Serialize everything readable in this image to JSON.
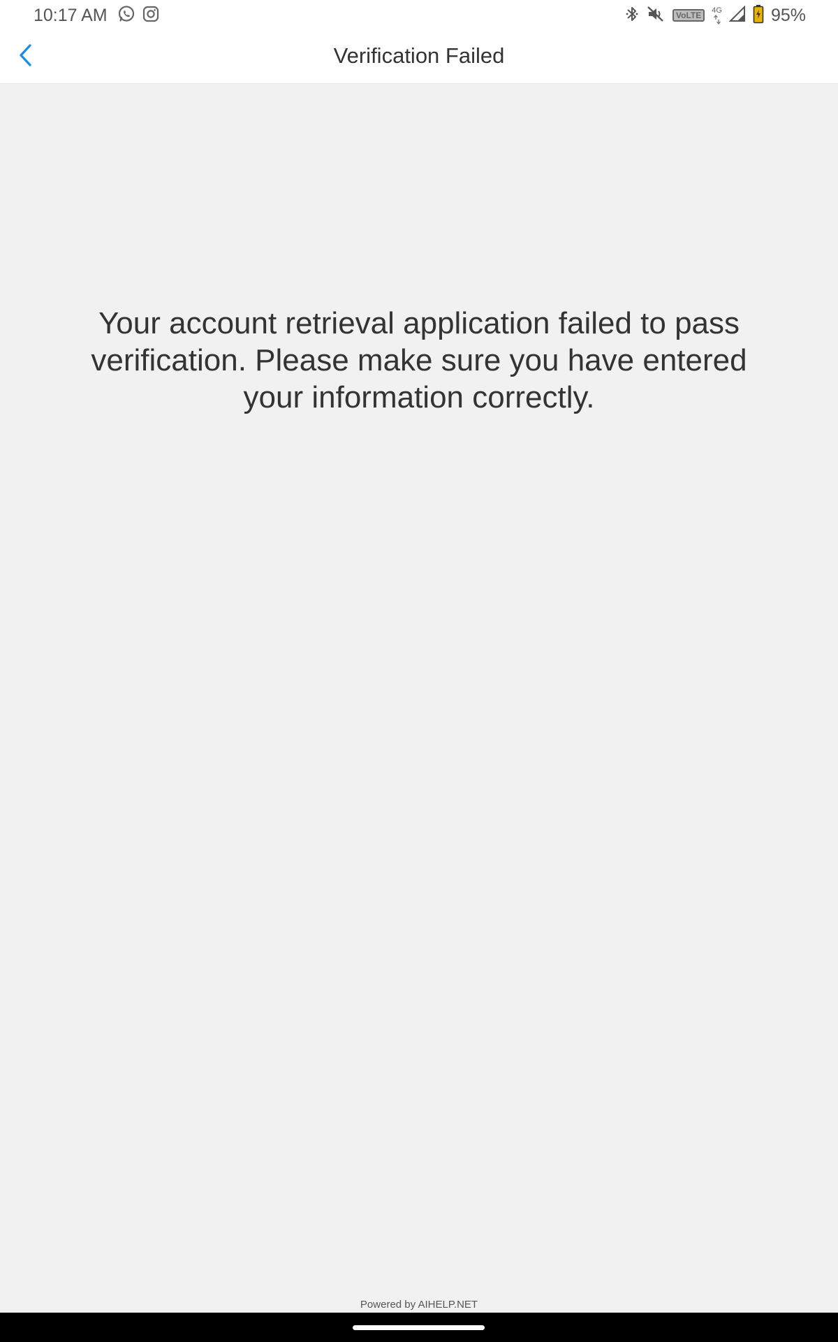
{
  "status_bar": {
    "time": "10:17 AM",
    "battery": "95%",
    "volte": "VoLTE",
    "network": "4G",
    "left_icons": [
      "whatsapp-icon",
      "instagram-icon"
    ],
    "right_icons": [
      "bluetooth-icon",
      "mute-icon",
      "volte-icon",
      "network-icon",
      "signal-icon",
      "battery-charging-icon"
    ]
  },
  "header": {
    "title": "Verification Failed",
    "back_icon": "chevron-left-icon"
  },
  "main": {
    "message": "Your account retrieval application failed to pass verification. Please make sure you have entered your information correctly."
  },
  "footer": {
    "powered_by": "Powered by AIHELP.NET"
  },
  "colors": {
    "accent": "#1a8ce8",
    "background": "#f1f1f1",
    "header_background": "#ffffff",
    "text": "#333333",
    "battery_fill": "#e8b400"
  }
}
